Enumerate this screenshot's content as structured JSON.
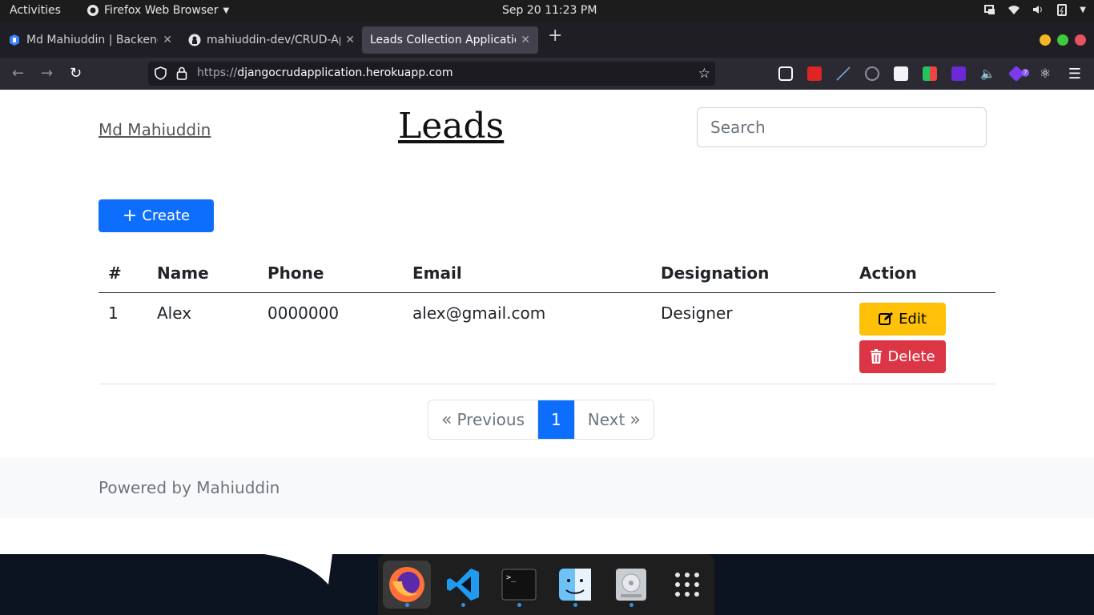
{
  "system_bar": {
    "activities": "Activities",
    "app_name": "Firefox Web Browser",
    "clock": "Sep 20  11:23 PM"
  },
  "browser": {
    "tabs": [
      {
        "title": "Md Mahiuddin | Backend",
        "active": false,
        "favicon": "portfolio-icon"
      },
      {
        "title": "mahiuddin-dev/CRUD-Ap",
        "active": false,
        "favicon": "github-icon"
      },
      {
        "title": "Leads Collection Application",
        "active": true,
        "favicon": "none"
      }
    ],
    "url_protocol": "https://",
    "url_host": "djangocrudapplication.herokuapp.com",
    "extension_badge": "7"
  },
  "page": {
    "brand": "Md Mahiuddin",
    "title": "Leads",
    "search_placeholder": "Search",
    "create_label": "Create",
    "table": {
      "headers": [
        "#",
        "Name",
        "Phone",
        "Email",
        "Designation",
        "Action"
      ],
      "rows": [
        {
          "num": "1",
          "name": "Alex",
          "phone": "0000000",
          "email": "alex@gmail.com",
          "designation": "Designer"
        }
      ],
      "edit_label": "Edit",
      "delete_label": "Delete"
    },
    "pagination": {
      "previous": "Previous",
      "current": "1",
      "next": "Next"
    },
    "footer": "Powered by Mahiuddin"
  },
  "colors": {
    "primary": "#0d6efd",
    "warning": "#ffc107",
    "danger": "#dc3545"
  }
}
